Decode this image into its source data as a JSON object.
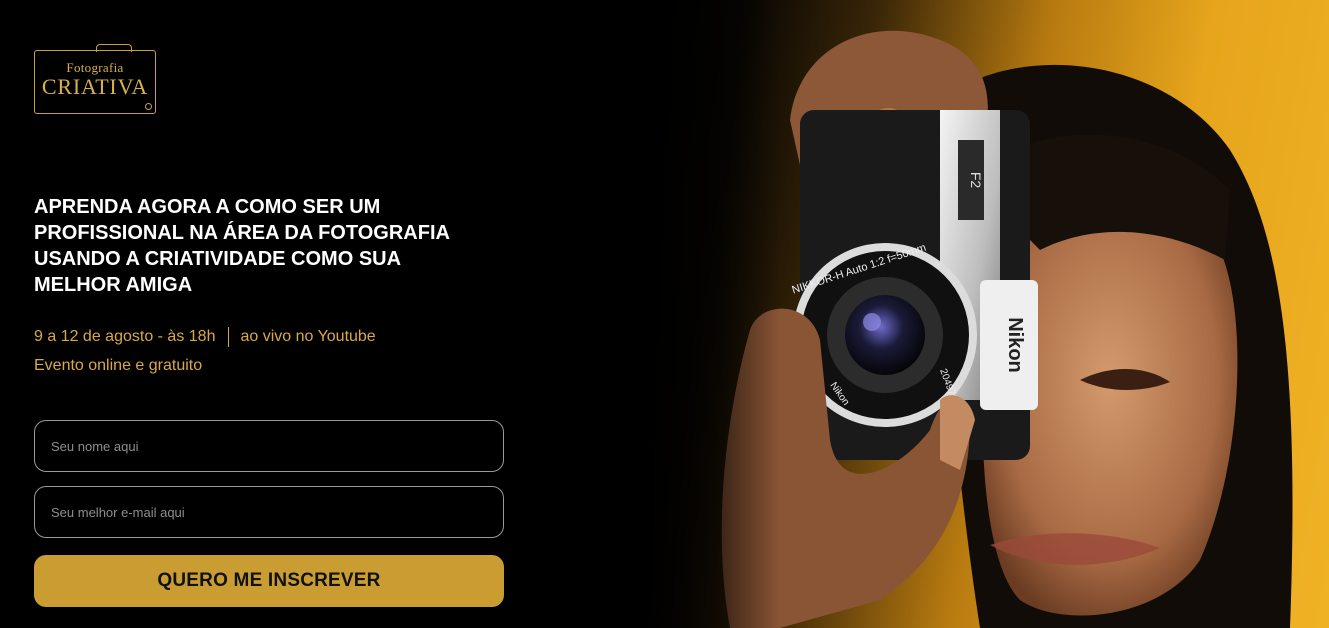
{
  "logo": {
    "line1": "Fotografia",
    "line2": "CRIATIVA"
  },
  "headline": "APRENDA AGORA A COMO SER UM PROFISSIONAL NA ÁREA DA FOTOGRAFIA USANDO A CRIATIVIDADE COMO SUA MELHOR AMIGA",
  "event": {
    "dates": "9 a 12 de agosto - às 18h",
    "channel": "ao vivo no Youtube",
    "type": "Evento online e gratuito"
  },
  "form": {
    "name_placeholder": "Seu nome aqui",
    "email_placeholder": "Seu melhor e-mail aqui",
    "submit_label": "QUERO ME INSCREVER"
  },
  "camera": {
    "lens_text": "NIKKOR-H Auto 1:2 f=50mm",
    "lens_serial": "2049717",
    "brand_lens": "Nikon",
    "brand_body": "Nikon"
  },
  "colors": {
    "accent": "#c99d32",
    "accent_text": "#d8a84a",
    "background": "#000000"
  }
}
